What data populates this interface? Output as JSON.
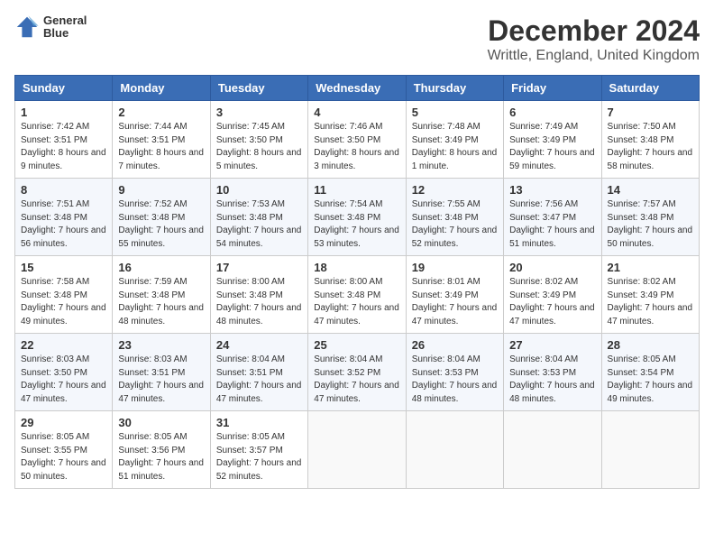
{
  "header": {
    "logo_line1": "General",
    "logo_line2": "Blue",
    "title": "December 2024",
    "subtitle": "Writtle, England, United Kingdom"
  },
  "calendar": {
    "headers": [
      "Sunday",
      "Monday",
      "Tuesday",
      "Wednesday",
      "Thursday",
      "Friday",
      "Saturday"
    ],
    "weeks": [
      [
        {
          "day": "1",
          "sunrise": "7:42 AM",
          "sunset": "3:51 PM",
          "daylight": "8 hours and 9 minutes."
        },
        {
          "day": "2",
          "sunrise": "7:44 AM",
          "sunset": "3:51 PM",
          "daylight": "8 hours and 7 minutes."
        },
        {
          "day": "3",
          "sunrise": "7:45 AM",
          "sunset": "3:50 PM",
          "daylight": "8 hours and 5 minutes."
        },
        {
          "day": "4",
          "sunrise": "7:46 AM",
          "sunset": "3:50 PM",
          "daylight": "8 hours and 3 minutes."
        },
        {
          "day": "5",
          "sunrise": "7:48 AM",
          "sunset": "3:49 PM",
          "daylight": "8 hours and 1 minute."
        },
        {
          "day": "6",
          "sunrise": "7:49 AM",
          "sunset": "3:49 PM",
          "daylight": "7 hours and 59 minutes."
        },
        {
          "day": "7",
          "sunrise": "7:50 AM",
          "sunset": "3:48 PM",
          "daylight": "7 hours and 58 minutes."
        }
      ],
      [
        {
          "day": "8",
          "sunrise": "7:51 AM",
          "sunset": "3:48 PM",
          "daylight": "7 hours and 56 minutes."
        },
        {
          "day": "9",
          "sunrise": "7:52 AM",
          "sunset": "3:48 PM",
          "daylight": "7 hours and 55 minutes."
        },
        {
          "day": "10",
          "sunrise": "7:53 AM",
          "sunset": "3:48 PM",
          "daylight": "7 hours and 54 minutes."
        },
        {
          "day": "11",
          "sunrise": "7:54 AM",
          "sunset": "3:48 PM",
          "daylight": "7 hours and 53 minutes."
        },
        {
          "day": "12",
          "sunrise": "7:55 AM",
          "sunset": "3:48 PM",
          "daylight": "7 hours and 52 minutes."
        },
        {
          "day": "13",
          "sunrise": "7:56 AM",
          "sunset": "3:47 PM",
          "daylight": "7 hours and 51 minutes."
        },
        {
          "day": "14",
          "sunrise": "7:57 AM",
          "sunset": "3:48 PM",
          "daylight": "7 hours and 50 minutes."
        }
      ],
      [
        {
          "day": "15",
          "sunrise": "7:58 AM",
          "sunset": "3:48 PM",
          "daylight": "7 hours and 49 minutes."
        },
        {
          "day": "16",
          "sunrise": "7:59 AM",
          "sunset": "3:48 PM",
          "daylight": "7 hours and 48 minutes."
        },
        {
          "day": "17",
          "sunrise": "8:00 AM",
          "sunset": "3:48 PM",
          "daylight": "7 hours and 48 minutes."
        },
        {
          "day": "18",
          "sunrise": "8:00 AM",
          "sunset": "3:48 PM",
          "daylight": "7 hours and 47 minutes."
        },
        {
          "day": "19",
          "sunrise": "8:01 AM",
          "sunset": "3:49 PM",
          "daylight": "7 hours and 47 minutes."
        },
        {
          "day": "20",
          "sunrise": "8:02 AM",
          "sunset": "3:49 PM",
          "daylight": "7 hours and 47 minutes."
        },
        {
          "day": "21",
          "sunrise": "8:02 AM",
          "sunset": "3:49 PM",
          "daylight": "7 hours and 47 minutes."
        }
      ],
      [
        {
          "day": "22",
          "sunrise": "8:03 AM",
          "sunset": "3:50 PM",
          "daylight": "7 hours and 47 minutes."
        },
        {
          "day": "23",
          "sunrise": "8:03 AM",
          "sunset": "3:51 PM",
          "daylight": "7 hours and 47 minutes."
        },
        {
          "day": "24",
          "sunrise": "8:04 AM",
          "sunset": "3:51 PM",
          "daylight": "7 hours and 47 minutes."
        },
        {
          "day": "25",
          "sunrise": "8:04 AM",
          "sunset": "3:52 PM",
          "daylight": "7 hours and 47 minutes."
        },
        {
          "day": "26",
          "sunrise": "8:04 AM",
          "sunset": "3:53 PM",
          "daylight": "7 hours and 48 minutes."
        },
        {
          "day": "27",
          "sunrise": "8:04 AM",
          "sunset": "3:53 PM",
          "daylight": "7 hours and 48 minutes."
        },
        {
          "day": "28",
          "sunrise": "8:05 AM",
          "sunset": "3:54 PM",
          "daylight": "7 hours and 49 minutes."
        }
      ],
      [
        {
          "day": "29",
          "sunrise": "8:05 AM",
          "sunset": "3:55 PM",
          "daylight": "7 hours and 50 minutes."
        },
        {
          "day": "30",
          "sunrise": "8:05 AM",
          "sunset": "3:56 PM",
          "daylight": "7 hours and 51 minutes."
        },
        {
          "day": "31",
          "sunrise": "8:05 AM",
          "sunset": "3:57 PM",
          "daylight": "7 hours and 52 minutes."
        },
        null,
        null,
        null,
        null
      ]
    ]
  }
}
